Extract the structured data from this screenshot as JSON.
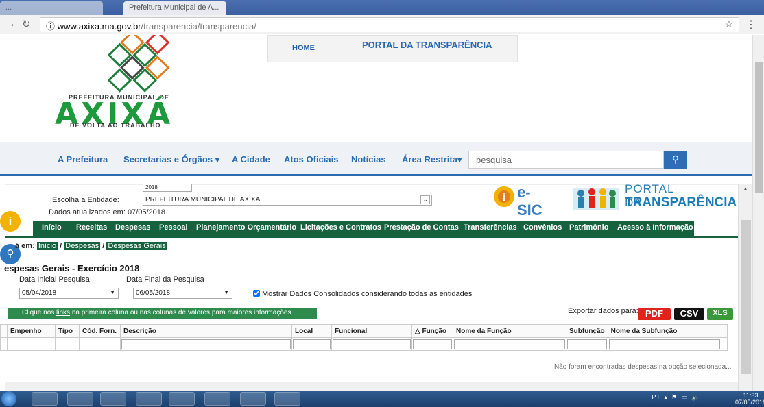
{
  "browser": {
    "tab1_title": "...",
    "tab2_title": "Prefeitura Municipal de A...",
    "url_domain": "www.axixa.ma.gov.br",
    "url_path": "/transparencia/transparencia/"
  },
  "header": {
    "logo_tagline_top": "PREFEITURA MUNICIPAL DE",
    "logo_name": "AXIXÁ",
    "logo_tagline_bottom": "DE VOLTA AO TRABALHO",
    "home_label": "HOME",
    "portal_label": "PORTAL DA TRANSPARÊNCIA"
  },
  "main_nav": {
    "items": [
      "A Prefeitura",
      "Secretarias e Órgãos ▾",
      "A Cidade",
      "Atos Oficiais",
      "Notícias",
      "Área Restrita▾"
    ],
    "search_placeholder": "pesquisa"
  },
  "frame": {
    "year_value": "2018",
    "entity_label": "Escolha a Entidade:",
    "entity_value": "PREFEITURA MUNICIPAL DE AXIXA",
    "updated_label": "Dados atualizados em: 07/05/2018",
    "esic_label": "e-SIC",
    "portal_line1": "PORTAL DA",
    "portal_line2": "TRANSPARÊNCIA",
    "nav": [
      "Início",
      "Receitas",
      "Despesas",
      "Pessoal",
      "Planejamento Orçamentário",
      "Licitações e Contratos",
      "Prestação de Contas",
      "Transferências",
      "Convênios",
      "Patrimônio",
      "Acesso à Informação"
    ],
    "breadcrumb": {
      "prefix": "á em:",
      "items": [
        "Início",
        "Despesas",
        "Despesas Gerais"
      ]
    },
    "title": "espesas Gerais - Exercício 2018",
    "date_start_label": "Data Inicial Pesquisa",
    "date_start_value": "05/04/2018",
    "date_end_label": "Data Final da Pesquisa",
    "date_end_value": "06/05/2018",
    "consolidated_label": "Mostrar Dados Consolidados considerando todas as entidades",
    "info_bar_pre": "Clique nos ",
    "info_bar_link": "links",
    "info_bar_post": " na primeira coluna ou nas colunas de valores para maiores informações.",
    "export_label": "Exportar dados para:",
    "export_pdf": "PDF",
    "export_csv": "CSV",
    "export_xls": "XLS",
    "columns": [
      "Empenho",
      "Tipo",
      "Cód. Forn.",
      "Descrição",
      "Local",
      "Funcional",
      "△  Função",
      "Nome da Função",
      "Subfunção",
      "Nome da Subfunção"
    ],
    "empty_message": "Não foram encontradas despesas na opção selecionada..."
  },
  "taskbar": {
    "lang": "PT",
    "time": "11:33",
    "date": "07/05/2018"
  },
  "colors": {
    "brand_blue": "#2b6cb0",
    "brand_green": "#16623f",
    "pdf_red": "#e0241b"
  }
}
